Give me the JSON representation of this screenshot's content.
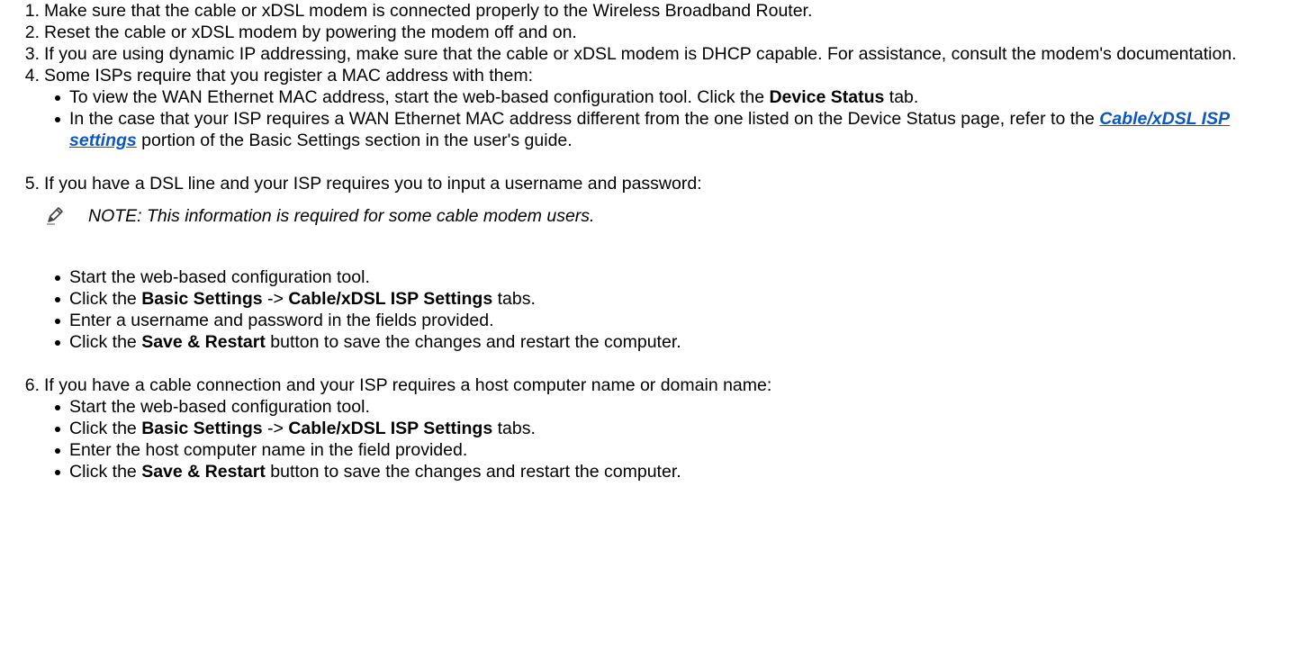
{
  "steps": [
    {
      "num": "1.",
      "text": "Make sure that the cable or xDSL modem is connected properly to the Wireless Broadband Router."
    },
    {
      "num": "2.",
      "text": "Reset the cable or xDSL modem by powering the modem off and on."
    },
    {
      "num": "3.",
      "text": "If you are using dynamic IP addressing, make sure that the cable or xDSL modem is DHCP capable. For assistance, consult the modem's documentation."
    },
    {
      "num": "4.",
      "text": "Some ISPs require that you register a MAC address with them:",
      "bullet1": {
        "pre": "To view the WAN Ethernet MAC address, start the web-based configuration tool. Click the ",
        "bold": "Device Status",
        "post": " tab."
      },
      "bullet2": {
        "pre": "In the case that your ISP requires a WAN Ethernet MAC address different from the one listed on the Device Status page, refer to the ",
        "link": "Cable/xDSL ISP settings",
        "post": " portion of the Basic Settings section in the user's guide."
      }
    },
    {
      "num": "5.",
      "text": "If you have a DSL line and your ISP requires you to input a username and password:",
      "note": "NOTE: This information is required for some cable modem users.",
      "b1": "Start the web-based configuration tool.",
      "b2": {
        "pre": "Click the ",
        "bold1": "Basic Settings",
        "mid": " -> ",
        "bold2": "Cable/xDSL ISP Settings",
        "post": " tabs."
      },
      "b3": "Enter a username and password in the fields provided.",
      "b4": {
        "pre": "Click the ",
        "bold": "Save & Restart",
        "post": " button to save the changes and restart the computer."
      }
    },
    {
      "num": "6.",
      "text": "If you have a cable connection and your ISP requires a host computer name or domain name:",
      "b1": "Start the web-based configuration tool.",
      "b2": {
        "pre": "Click the ",
        "bold1": "Basic Settings",
        "mid": " -> ",
        "bold2": "Cable/xDSL ISP Settings",
        "post": " tabs."
      },
      "b3": "Enter the host computer name in the field provided.",
      "b4": {
        "pre": "Click the ",
        "bold": "Save & Restart",
        "post": " button to save the changes and restart the computer."
      }
    }
  ],
  "icons": {
    "note": "pencil-icon"
  },
  "colors": {
    "link": "#0b57c8"
  }
}
